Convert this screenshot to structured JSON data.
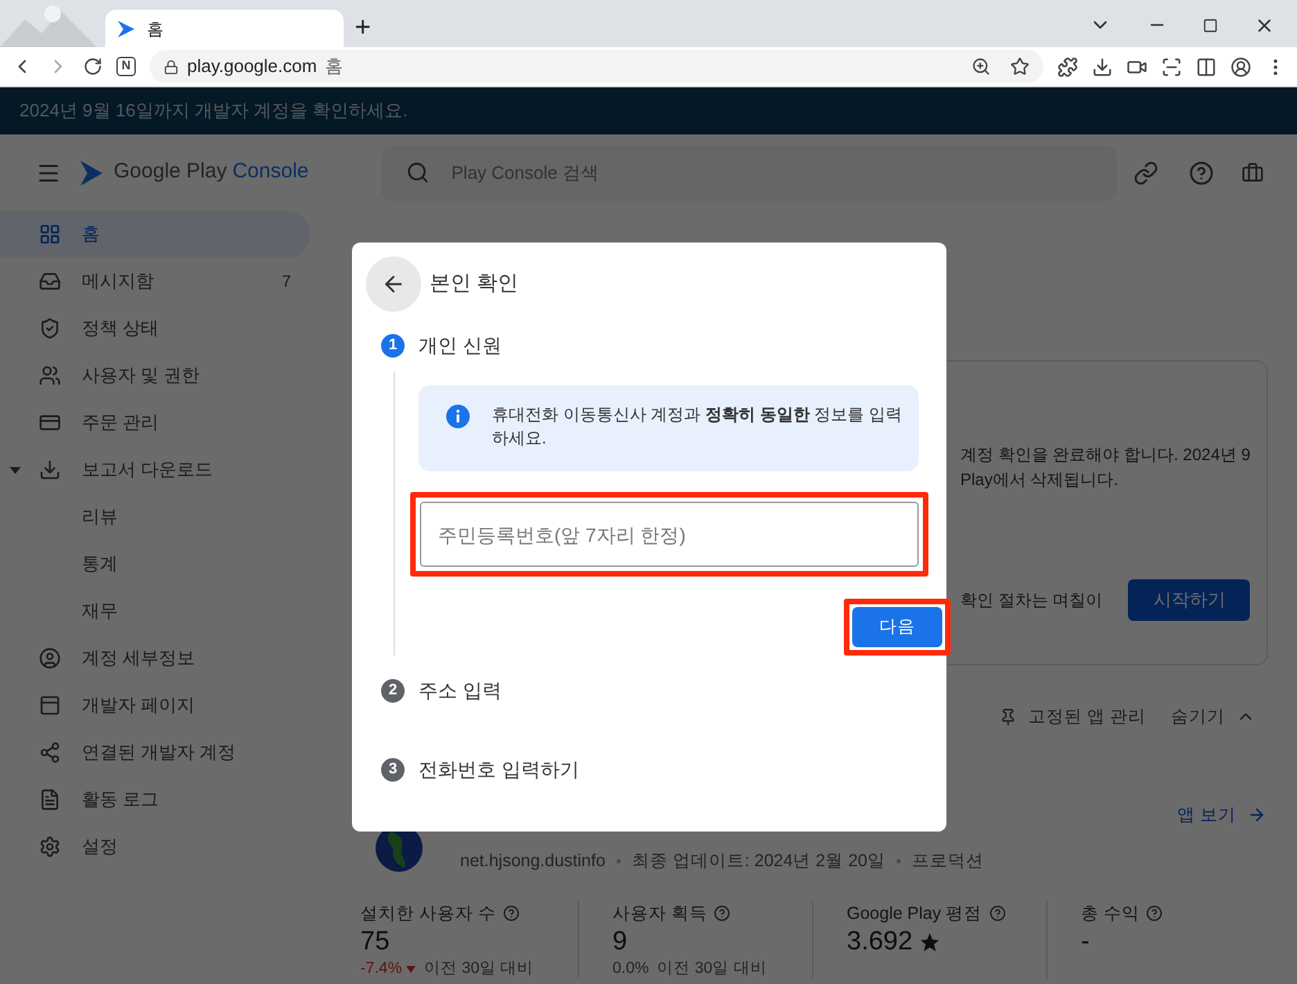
{
  "browser": {
    "tab_title": "홈",
    "new_tab": "+",
    "url_host": "play.google.com",
    "url_page": "홈",
    "extension_label": "N"
  },
  "banner": "2024년 9월 16일까지 개발자 계정을 확인하세요.",
  "header": {
    "logo_brand": "Google Play",
    "logo_product": "Console",
    "search_placeholder": "Play Console 검색"
  },
  "sidebar": {
    "items": [
      {
        "label": "홈",
        "selected": true
      },
      {
        "label": "메시지함",
        "selected": false,
        "badge": "7"
      },
      {
        "label": "정책 상태",
        "selected": false
      },
      {
        "label": "사용자 및 권한",
        "selected": false
      },
      {
        "label": "주문 관리",
        "selected": false
      },
      {
        "label": "보고서 다운로드",
        "selected": false,
        "expanded": true,
        "children": [
          {
            "label": "리뷰",
            "selected": false
          },
          {
            "label": "통계",
            "selected": false
          },
          {
            "label": "재무",
            "selected": false
          }
        ]
      },
      {
        "label": "계정 세부정보",
        "selected": false
      },
      {
        "label": "개발자 페이지",
        "selected": false
      },
      {
        "label": "연결된 개발자 계정",
        "selected": false
      },
      {
        "label": "활동 로그",
        "selected": false
      },
      {
        "label": "설정",
        "selected": false
      }
    ]
  },
  "main": {
    "notice_lines": [
      "계정 확인을 완료해야 합니다. 2024년 9",
      "Play에서 삭제됩니다."
    ],
    "notice_footer": "확인 절차는 며칠이",
    "start_button": "시작하기",
    "pinned_manage": "고정된 앱 관리",
    "hide": "숨기기",
    "view_app": "앱 보기",
    "app": {
      "package": "net.hjsong.dustinfo",
      "updated": "최종 업데이트: 2024년 2월 20일",
      "track": "프로덕션"
    },
    "stats": [
      {
        "kind": "change",
        "label": "설치한 사용자 수",
        "value": "75",
        "change": "-7.4%",
        "compare": "이전 30일 대비"
      },
      {
        "kind": "flat",
        "label": "사용자 획득",
        "value": "9",
        "change": "0.0%",
        "compare": "이전 30일 대비"
      },
      {
        "kind": "rating",
        "label": "Google Play 평점",
        "value": "3.692"
      },
      {
        "kind": "plain",
        "label": "총 수익",
        "value": "-"
      }
    ]
  },
  "dialog": {
    "title": "본인 확인",
    "steps": [
      {
        "number": "1",
        "label": "개인 신원",
        "selected": true
      },
      {
        "number": "2",
        "label": "주소 입력",
        "selected": false
      },
      {
        "number": "3",
        "label": "전화번호 입력하기",
        "selected": false
      }
    ],
    "info": "휴대전화 이동통신사 계정과 **정확히 동일한** 정보를 입력하세요.",
    "field": {
      "placeholder": "주민등록번호(앞 7자리 한정)",
      "highlighted": true
    },
    "next_button": {
      "label": "다음",
      "highlighted": true
    }
  }
}
